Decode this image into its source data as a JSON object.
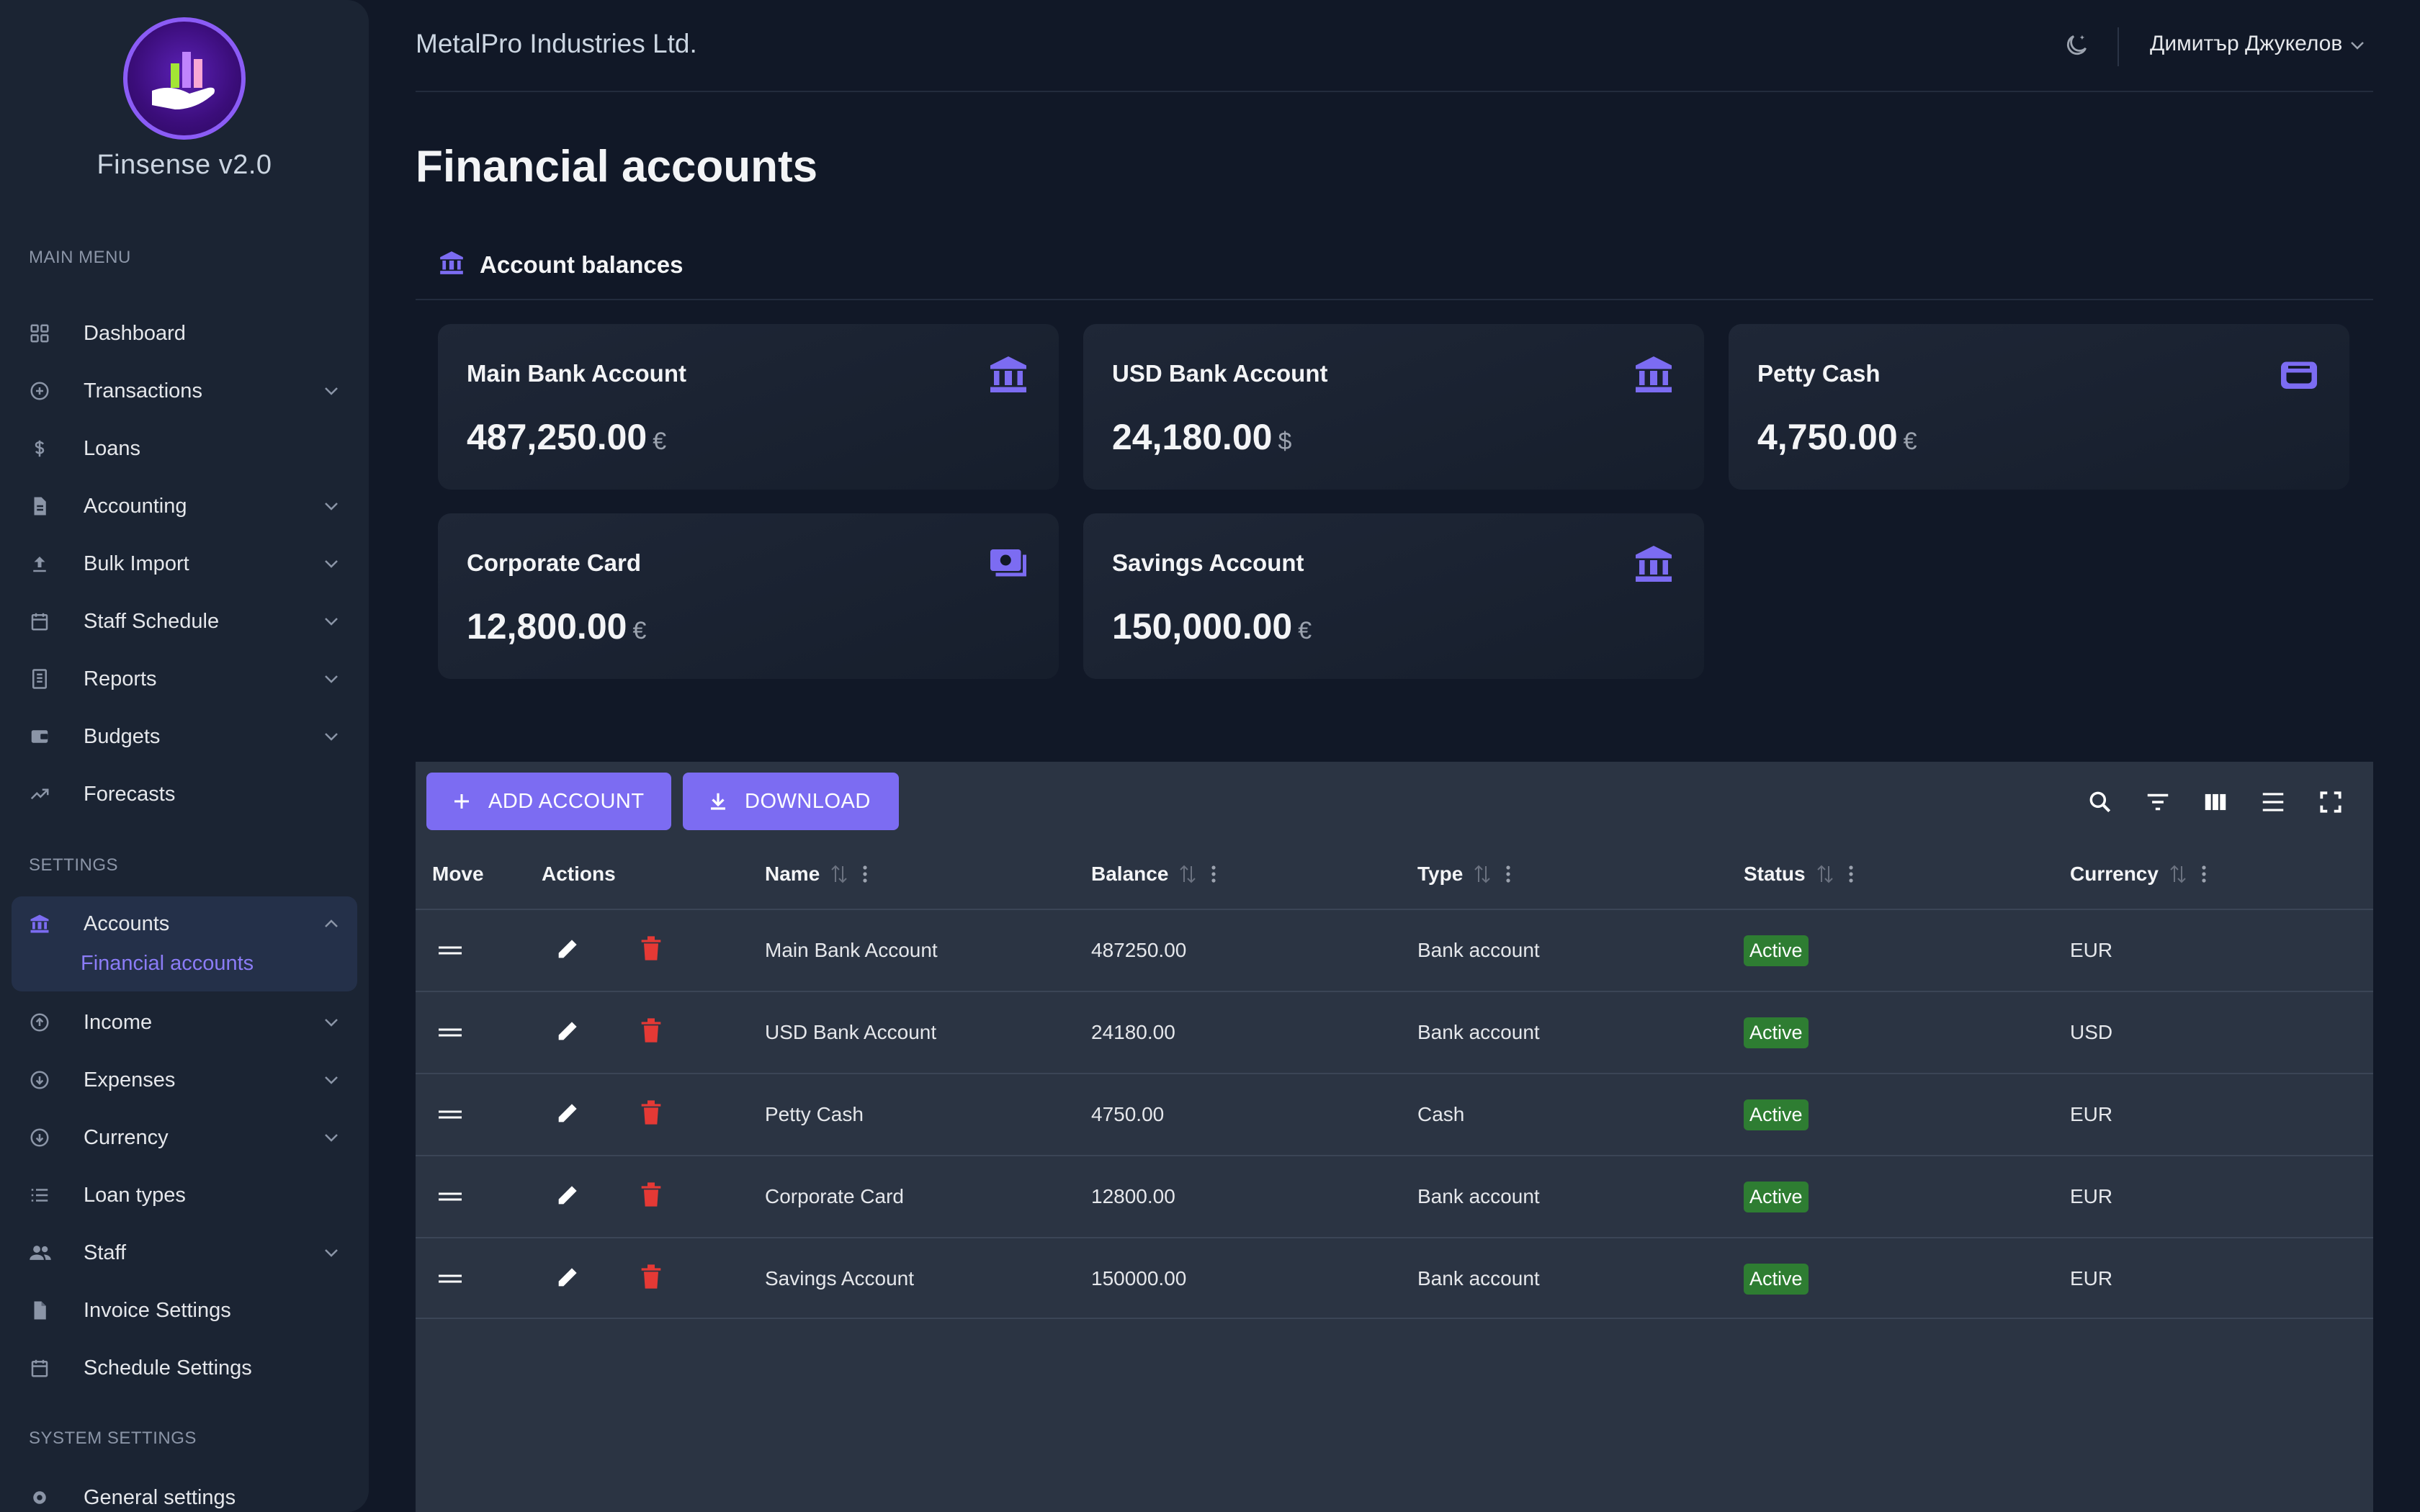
{
  "brand": {
    "name": "Finsense v2.0"
  },
  "header": {
    "company": "MetalPro Industries Ltd.",
    "user": "Димитър Джукелов",
    "page_title": "Financial accounts"
  },
  "sidebar": {
    "main_menu_title": "MAIN MENU",
    "settings_title": "SETTINGS",
    "system_title": "SYSTEM SETTINGS",
    "main_items": [
      {
        "label": "Dashboard",
        "icon": "grid-icon"
      },
      {
        "label": "Transactions",
        "icon": "plus-circle-icon"
      },
      {
        "label": "Loans",
        "icon": "dollar-icon"
      },
      {
        "label": "Accounting",
        "icon": "document-icon"
      },
      {
        "label": "Bulk Import",
        "icon": "upload-icon"
      },
      {
        "label": "Staff Schedule",
        "icon": "calendar-icon"
      },
      {
        "label": "Reports",
        "icon": "report-icon"
      },
      {
        "label": "Budgets",
        "icon": "wallet-icon"
      },
      {
        "label": "Forecasts",
        "icon": "trend-icon"
      }
    ],
    "settings_items": [
      {
        "label": "Accounts",
        "icon": "bank-icon"
      },
      {
        "label": "Income",
        "icon": "arrow-up-circle-icon"
      },
      {
        "label": "Expenses",
        "icon": "arrow-down-circle-icon"
      },
      {
        "label": "Currency",
        "icon": "arrow-down-circle-icon"
      },
      {
        "label": "Loan types",
        "icon": "list-icon"
      },
      {
        "label": "Staff",
        "icon": "people-icon"
      },
      {
        "label": "Invoice Settings",
        "icon": "file-icon"
      },
      {
        "label": "Schedule Settings",
        "icon": "calendar-icon"
      }
    ],
    "accounts_sub": "Financial accounts",
    "system_items": [
      {
        "label": "General settings",
        "icon": "gear-icon"
      }
    ]
  },
  "balances": {
    "title": "Account balances",
    "cards": [
      {
        "name": "Main Bank Account",
        "amount": "487,250.00",
        "currency": "€",
        "icon": "bank-icon"
      },
      {
        "name": "USD Bank Account",
        "amount": "24,180.00",
        "currency": "$",
        "icon": "bank-icon"
      },
      {
        "name": "Petty Cash",
        "amount": "4,750.00",
        "currency": "€",
        "icon": "wallet-icon"
      },
      {
        "name": "Corporate Card",
        "amount": "12,800.00",
        "currency": "€",
        "icon": "cash-icon"
      },
      {
        "name": "Savings Account",
        "amount": "150,000.00",
        "currency": "€",
        "icon": "bank-icon"
      }
    ]
  },
  "toolbar": {
    "add_label": "ADD ACCOUNT",
    "download_label": "DOWNLOAD"
  },
  "table": {
    "headers": {
      "move": "Move",
      "actions": "Actions",
      "name": "Name",
      "balance": "Balance",
      "type": "Type",
      "status": "Status",
      "currency": "Currency"
    },
    "rows": [
      {
        "name": "Main Bank Account",
        "balance": "487250.00",
        "type": "Bank account",
        "status": "Active",
        "currency": "EUR"
      },
      {
        "name": "USD Bank Account",
        "balance": "24180.00",
        "type": "Bank account",
        "status": "Active",
        "currency": "USD"
      },
      {
        "name": "Petty Cash",
        "balance": "4750.00",
        "type": "Cash",
        "status": "Active",
        "currency": "EUR"
      },
      {
        "name": "Corporate Card",
        "balance": "12800.00",
        "type": "Bank account",
        "status": "Active",
        "currency": "EUR"
      },
      {
        "name": "Savings Account",
        "balance": "150000.00",
        "type": "Bank account",
        "status": "Active",
        "currency": "EUR"
      }
    ]
  },
  "colors": {
    "accent": "#7c6cf2",
    "active_badge": "#2e7d32",
    "delete": "#e53935",
    "background": "#111827",
    "sidebar": "#1b2433"
  }
}
